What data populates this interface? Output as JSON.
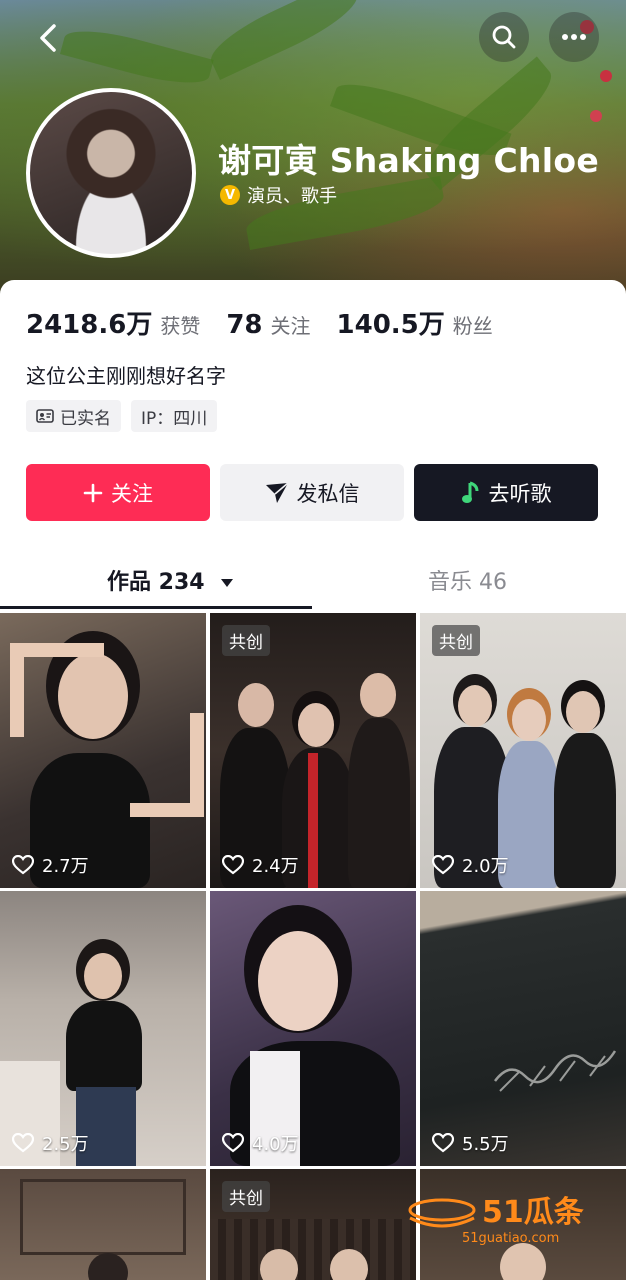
{
  "profile": {
    "name": "谢可寅 Shaking Chloe",
    "verify_text": "演员、歌手",
    "verify_mark": "V",
    "bio": "这位公主刚刚想好名字"
  },
  "stats": [
    {
      "num": "2418.6万",
      "label": "获赞"
    },
    {
      "num": "78",
      "label": "关注"
    },
    {
      "num": "140.5万",
      "label": "粉丝"
    }
  ],
  "tags": {
    "real_name": "已实名",
    "ip": "IP：四川"
  },
  "buttons": {
    "follow": "关注",
    "message": "发私信",
    "music": "去听歌"
  },
  "tabs": {
    "works": "作品 234",
    "music": "音乐 46"
  },
  "videos": [
    {
      "likes": "2.7万",
      "badge": ""
    },
    {
      "likes": "2.4万",
      "badge": "共创"
    },
    {
      "likes": "2.0万",
      "badge": "共创"
    },
    {
      "likes": "2.5万",
      "badge": ""
    },
    {
      "likes": "4.0万",
      "badge": ""
    },
    {
      "likes": "5.5万",
      "badge": ""
    },
    {
      "likes": "",
      "badge": ""
    },
    {
      "likes": "",
      "badge": "共创"
    },
    {
      "likes": "",
      "badge": ""
    }
  ],
  "watermark": {
    "brand": "51瓜条",
    "domain": "51guatiao.com"
  },
  "colors": {
    "accent": "#fe2c55",
    "dark": "#161823",
    "verify": "#f5b800"
  }
}
